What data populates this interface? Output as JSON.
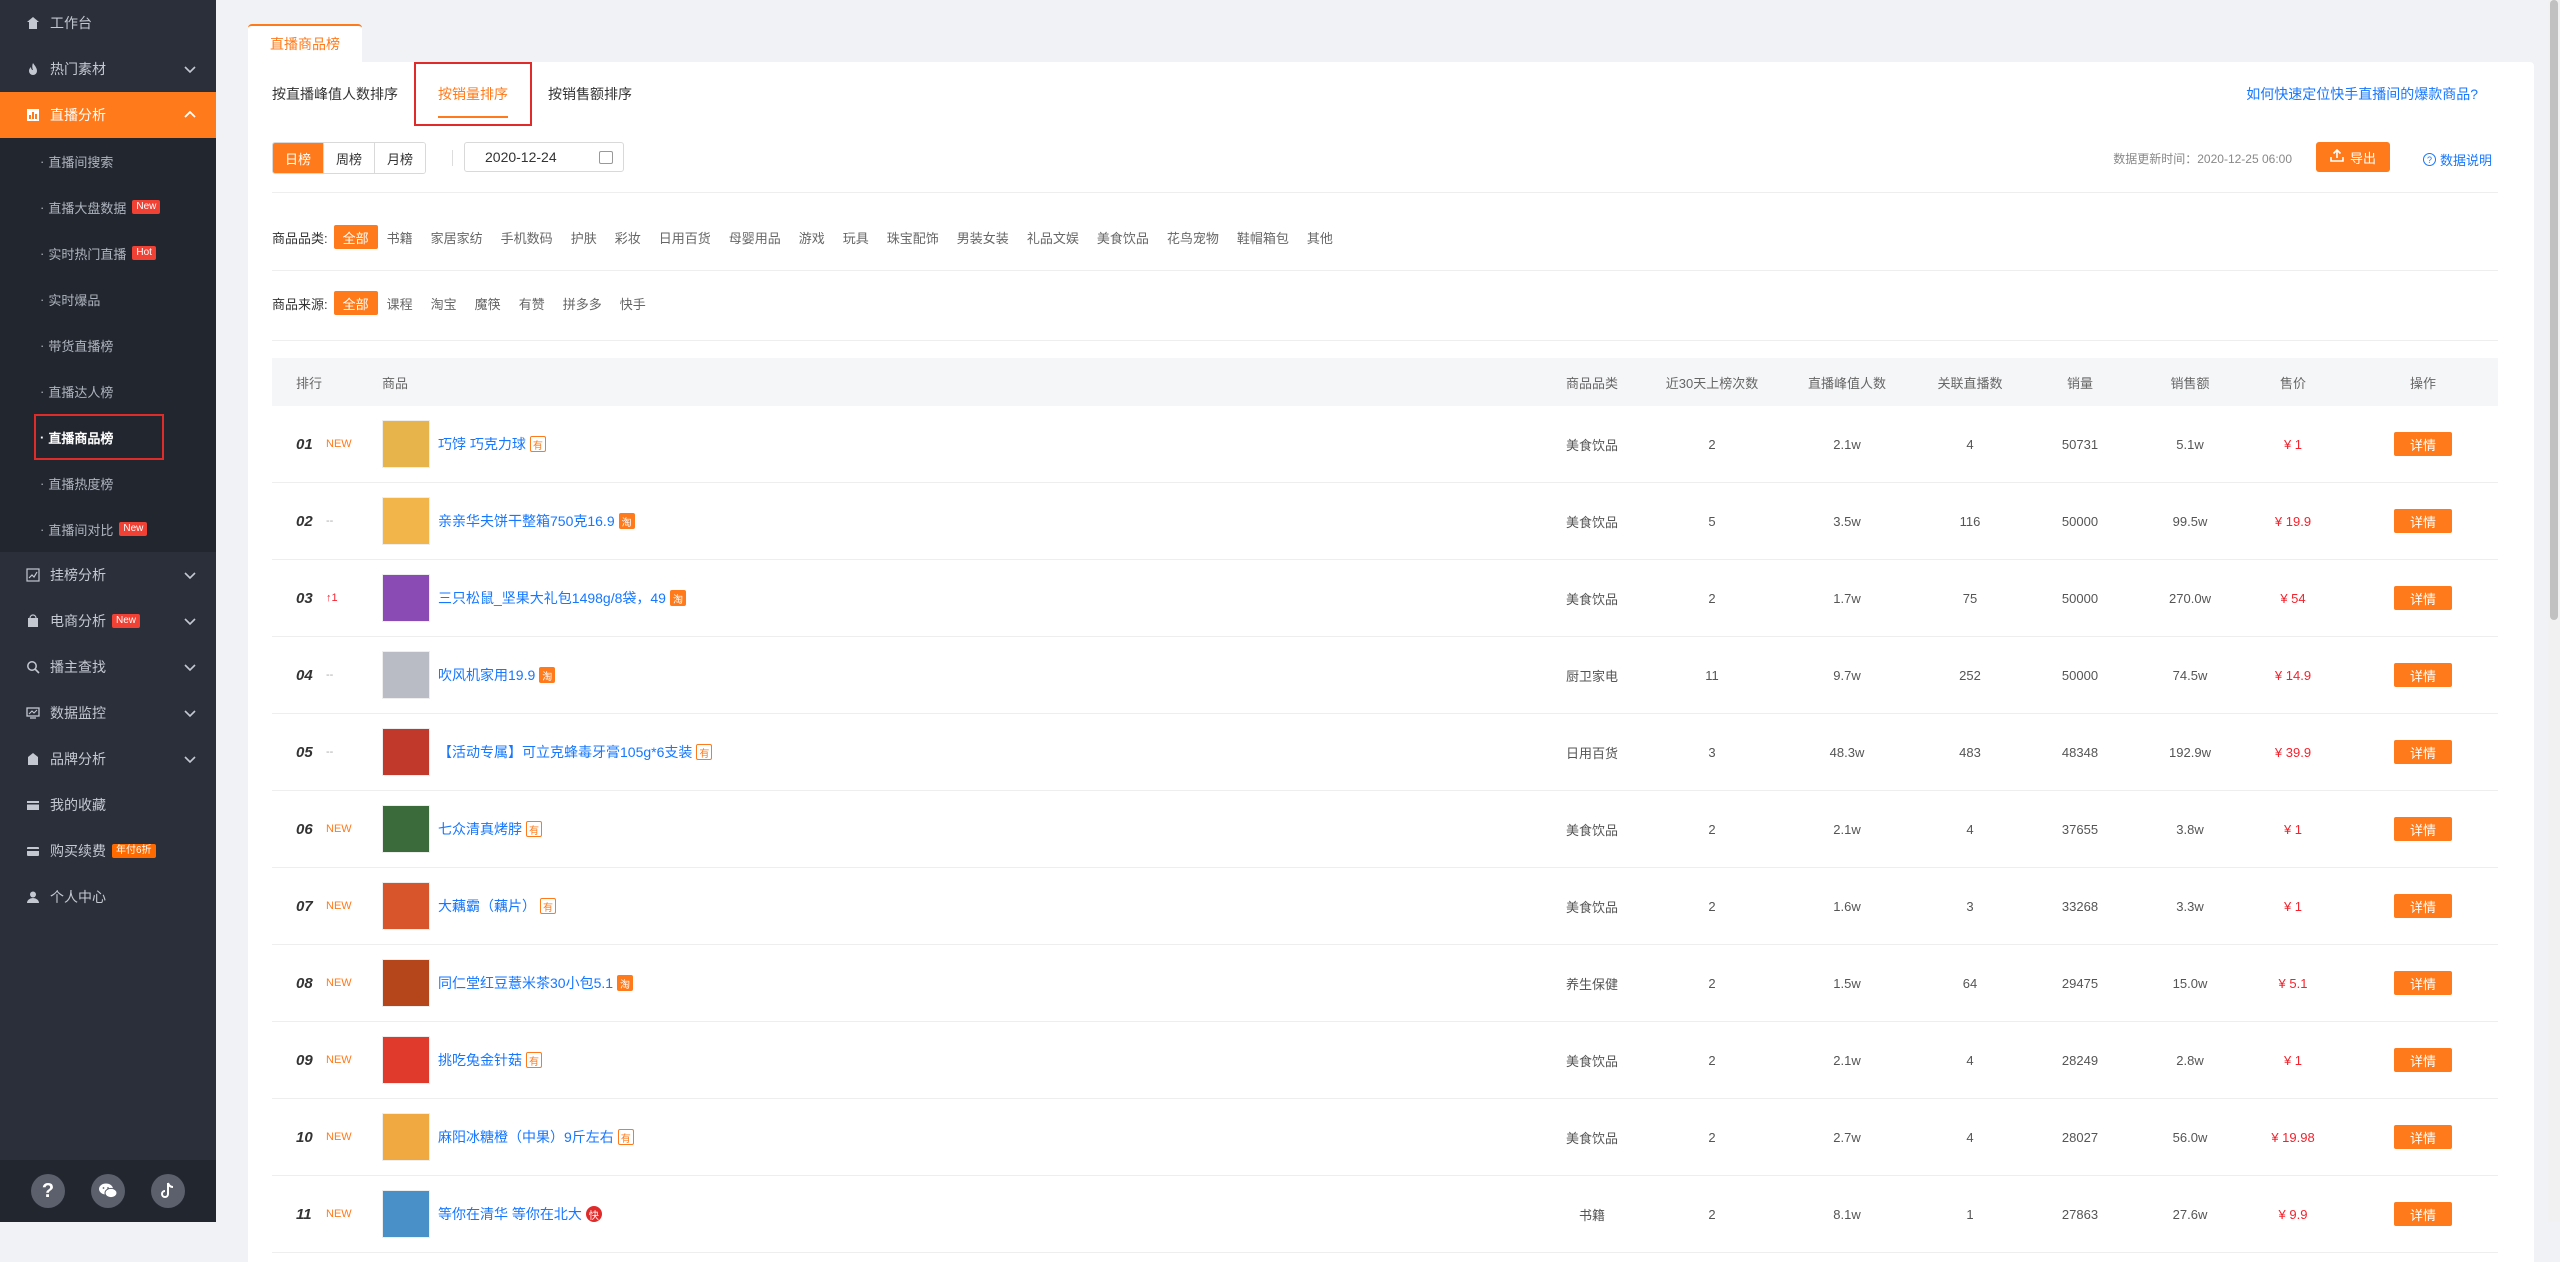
{
  "sidebar": {
    "items": [
      {
        "label": "工作台",
        "icon": "home-icon"
      },
      {
        "label": "热门素材",
        "icon": "fire-icon"
      },
      {
        "label": "直播分析",
        "icon": "bar-chart-icon"
      }
    ],
    "sub_items": [
      {
        "label": "直播间搜索",
        "badge": ""
      },
      {
        "label": "直播大盘数据",
        "badge": "New"
      },
      {
        "label": "实时热门直播",
        "badge": "Hot"
      },
      {
        "label": "实时爆品",
        "badge": ""
      },
      {
        "label": "带货直播榜",
        "badge": ""
      },
      {
        "label": "直播达人榜",
        "badge": ""
      },
      {
        "label": "直播商品榜",
        "badge": ""
      },
      {
        "label": "直播热度榜",
        "badge": ""
      },
      {
        "label": "直播间对比",
        "badge": "New"
      }
    ],
    "lower_items": [
      {
        "label": "挂榜分析",
        "badge": ""
      },
      {
        "label": "电商分析",
        "badge": "New"
      },
      {
        "label": "播主查找",
        "badge": ""
      },
      {
        "label": "数据监控",
        "badge": ""
      },
      {
        "label": "品牌分析",
        "badge": ""
      },
      {
        "label": "我的收藏",
        "badge": ""
      },
      {
        "label": "购买续费",
        "badge": "年付6折"
      },
      {
        "label": "个人中心",
        "badge": ""
      }
    ],
    "bottom": {
      "help": "?"
    }
  },
  "page_tab": "直播商品榜",
  "sort_tabs": [
    "按直播峰值人数排序",
    "按销量排序",
    "按销售额排序"
  ],
  "help_link": "如何快速定位快手直播间的爆款商品?",
  "period": [
    "日榜",
    "周榜",
    "月榜"
  ],
  "date": "2020-12-24",
  "update_time": "数据更新时间：2020-12-25 06:00",
  "export_label": "导出",
  "data_desc_label": "数据说明",
  "category_filter": {
    "label": "商品品类:",
    "options": [
      "全部",
      "书籍",
      "家居家纺",
      "手机数码",
      "护肤",
      "彩妆",
      "日用百货",
      "母婴用品",
      "游戏",
      "玩具",
      "珠宝配饰",
      "男装女装",
      "礼品文娱",
      "美食饮品",
      "花鸟宠物",
      "鞋帽箱包",
      "其他"
    ]
  },
  "source_filter": {
    "label": "商品来源:",
    "options": [
      "全部",
      "课程",
      "淘宝",
      "魔筷",
      "有赞",
      "拼多多",
      "快手"
    ]
  },
  "table": {
    "headers": {
      "rank": "排行",
      "product": "商品",
      "category": "商品品类",
      "count": "近30天上榜次数",
      "peak": "直播峰值人数",
      "related": "关联直播数",
      "sales": "销量",
      "amount": "销售额",
      "price": "售价",
      "op": "操作"
    },
    "detail_label": "详情",
    "rows": [
      {
        "rank": "01",
        "change": "NEW",
        "name": "巧饽 巧克力球",
        "src": "有",
        "category": "美食饮品",
        "count": "2",
        "peak": "2.1w",
        "related": "4",
        "sales": "50731",
        "amount": "5.1w",
        "price": "¥ 1",
        "thumb": "#e6b44a"
      },
      {
        "rank": "02",
        "change": "--",
        "name": "亲亲华夫饼干整箱750克16.9",
        "src": "淘",
        "category": "美食饮品",
        "count": "5",
        "peak": "3.5w",
        "related": "116",
        "sales": "50000",
        "amount": "99.5w",
        "price": "¥ 19.9",
        "thumb": "#f2b54a"
      },
      {
        "rank": "03",
        "change": "↑1",
        "name": "三只松鼠_坚果大礼包1498g/8袋，49",
        "src": "淘",
        "category": "美食饮品",
        "count": "2",
        "peak": "1.7w",
        "related": "75",
        "sales": "50000",
        "amount": "270.0w",
        "price": "¥ 54",
        "thumb": "#8a4bb5"
      },
      {
        "rank": "04",
        "change": "--",
        "name": "吹风机家用19.9",
        "src": "淘",
        "category": "厨卫家电",
        "count": "11",
        "peak": "9.7w",
        "related": "252",
        "sales": "50000",
        "amount": "74.5w",
        "price": "¥ 14.9",
        "thumb": "#b9bcc4"
      },
      {
        "rank": "05",
        "change": "--",
        "name": "【活动专属】可立克蜂毒牙膏105g*6支装",
        "src": "有",
        "category": "日用百货",
        "count": "3",
        "peak": "48.3w",
        "related": "483",
        "sales": "48348",
        "amount": "192.9w",
        "price": "¥ 39.9",
        "thumb": "#c0392b"
      },
      {
        "rank": "06",
        "change": "NEW",
        "name": "七众清真烤脖",
        "src": "有",
        "category": "美食饮品",
        "count": "2",
        "peak": "2.1w",
        "related": "4",
        "sales": "37655",
        "amount": "3.8w",
        "price": "¥ 1",
        "thumb": "#3b6b3a"
      },
      {
        "rank": "07",
        "change": "NEW",
        "name": "大藕霸（藕片）",
        "src": "有",
        "category": "美食饮品",
        "count": "2",
        "peak": "1.6w",
        "related": "3",
        "sales": "33268",
        "amount": "3.3w",
        "price": "¥ 1",
        "thumb": "#d8552b"
      },
      {
        "rank": "08",
        "change": "NEW",
        "name": "同仁堂红豆薏米茶30小包5.1",
        "src": "淘",
        "category": "养生保健",
        "count": "2",
        "peak": "1.5w",
        "related": "64",
        "sales": "29475",
        "amount": "15.0w",
        "price": "¥ 5.1",
        "thumb": "#b5451b"
      },
      {
        "rank": "09",
        "change": "NEW",
        "name": "挑吃兔金针菇",
        "src": "有",
        "category": "美食饮品",
        "count": "2",
        "peak": "2.1w",
        "related": "4",
        "sales": "28249",
        "amount": "2.8w",
        "price": "¥ 1",
        "thumb": "#e03a2c"
      },
      {
        "rank": "10",
        "change": "NEW",
        "name": "麻阳冰糖橙（中果）9斤左右",
        "src": "有",
        "category": "美食饮品",
        "count": "2",
        "peak": "2.7w",
        "related": "4",
        "sales": "28027",
        "amount": "56.0w",
        "price": "¥ 19.98",
        "thumb": "#f0a840"
      },
      {
        "rank": "11",
        "change": "NEW",
        "name": "等你在清华 等你在北大",
        "src": "快",
        "category": "书籍",
        "count": "2",
        "peak": "8.1w",
        "related": "1",
        "sales": "27863",
        "amount": "27.6w",
        "price": "¥ 9.9",
        "thumb": "#4a90c8"
      }
    ]
  }
}
